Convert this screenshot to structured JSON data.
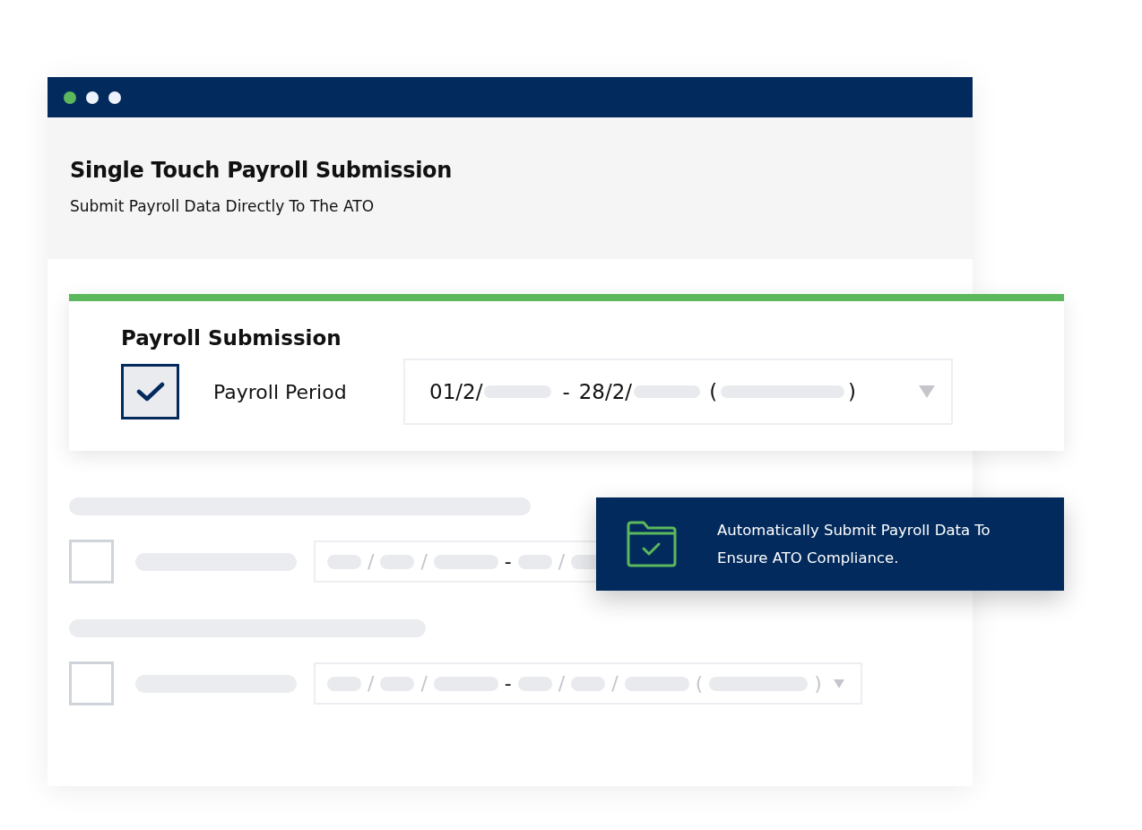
{
  "window": {
    "dots": [
      {
        "color": "#5cb85c"
      },
      {
        "color": "#eef2fa"
      },
      {
        "color": "#eef2fa"
      }
    ],
    "title": "Single Touch Payroll Submission",
    "subtitle": "Submit Payroll Data Directly To The ATO"
  },
  "submission_card": {
    "heading": "Payroll Submission",
    "checked": true,
    "label": "Payroll Period",
    "period": {
      "start": "01/2/",
      "separator": "-",
      "end": "28/2/",
      "open_paren": "(",
      "close_paren": ")"
    }
  },
  "placeholder_rows": [
    {
      "checked": false,
      "dropdown": false,
      "tokens": [
        {
          "kind": "bar"
        },
        {
          "kind": "text",
          "text": "/"
        },
        {
          "kind": "bar"
        },
        {
          "kind": "text",
          "text": "/"
        },
        {
          "kind": "longbar"
        },
        {
          "kind": "text",
          "text": "-"
        },
        {
          "kind": "bar"
        },
        {
          "kind": "text",
          "text": "/"
        },
        {
          "kind": "bar"
        }
      ]
    },
    {
      "checked": false,
      "dropdown": true,
      "tokens": [
        {
          "kind": "bar"
        },
        {
          "kind": "text",
          "text": "/"
        },
        {
          "kind": "bar"
        },
        {
          "kind": "text",
          "text": "/"
        },
        {
          "kind": "longbar"
        },
        {
          "kind": "text",
          "text": "-"
        },
        {
          "kind": "bar"
        },
        {
          "kind": "text",
          "text": "/"
        },
        {
          "kind": "bar"
        },
        {
          "kind": "text",
          "text": "/"
        },
        {
          "kind": "longbar"
        },
        {
          "kind": "text",
          "text": "("
        },
        {
          "kind": "widebar"
        },
        {
          "kind": "text",
          "text": ")"
        }
      ]
    }
  ],
  "callout": {
    "text": "Automatically Submit Payroll Data To Ensure ATO Compliance."
  }
}
